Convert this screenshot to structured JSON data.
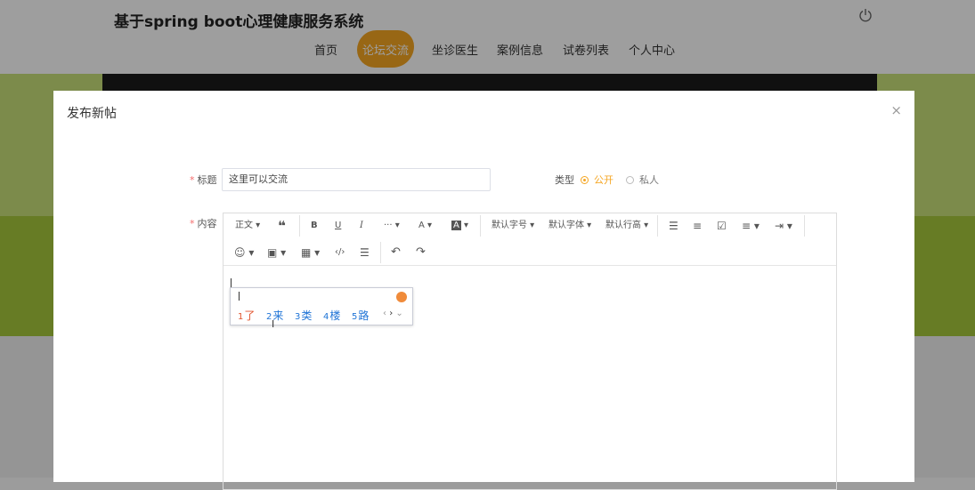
{
  "site": {
    "title": "基于spring boot心理健康服务系统",
    "nav": [
      "首页",
      "论坛交流",
      "坐诊医生",
      "案例信息",
      "试卷列表",
      "个人中心"
    ],
    "active_nav": "论坛交流",
    "accent": "#f5a623"
  },
  "modal": {
    "title": "发布新帖",
    "close": "×",
    "title_label": "标题",
    "title_value": "这里可以交流",
    "type_label": "类型",
    "type_options": [
      "公开",
      "私人"
    ],
    "type_selected": "公开",
    "content_label": "内容"
  },
  "toolbar": {
    "row1": [
      "正文",
      "❝",
      "B",
      "U",
      "I",
      "···",
      "A",
      "A",
      "默认字号",
      "默认字体",
      "默认行高",
      "list-icon",
      "ordered-list-icon",
      "todo-icon",
      "align-icon",
      "indent-icon"
    ],
    "row2": [
      "emoji-icon",
      "image-icon",
      "table-icon",
      "code-icon",
      "divider-icon",
      "undo-icon",
      "redo-icon"
    ],
    "paragraph": "正文",
    "font_size": "默认字号",
    "font_family": "默认字体",
    "line_height": "默认行高"
  },
  "ime": {
    "candidates": [
      {
        "num": "1",
        "text": "了"
      },
      {
        "num": "2",
        "text": "来"
      },
      {
        "num": "3",
        "text": "类"
      },
      {
        "num": "4",
        "text": "楼"
      },
      {
        "num": "5",
        "text": "路"
      }
    ]
  }
}
